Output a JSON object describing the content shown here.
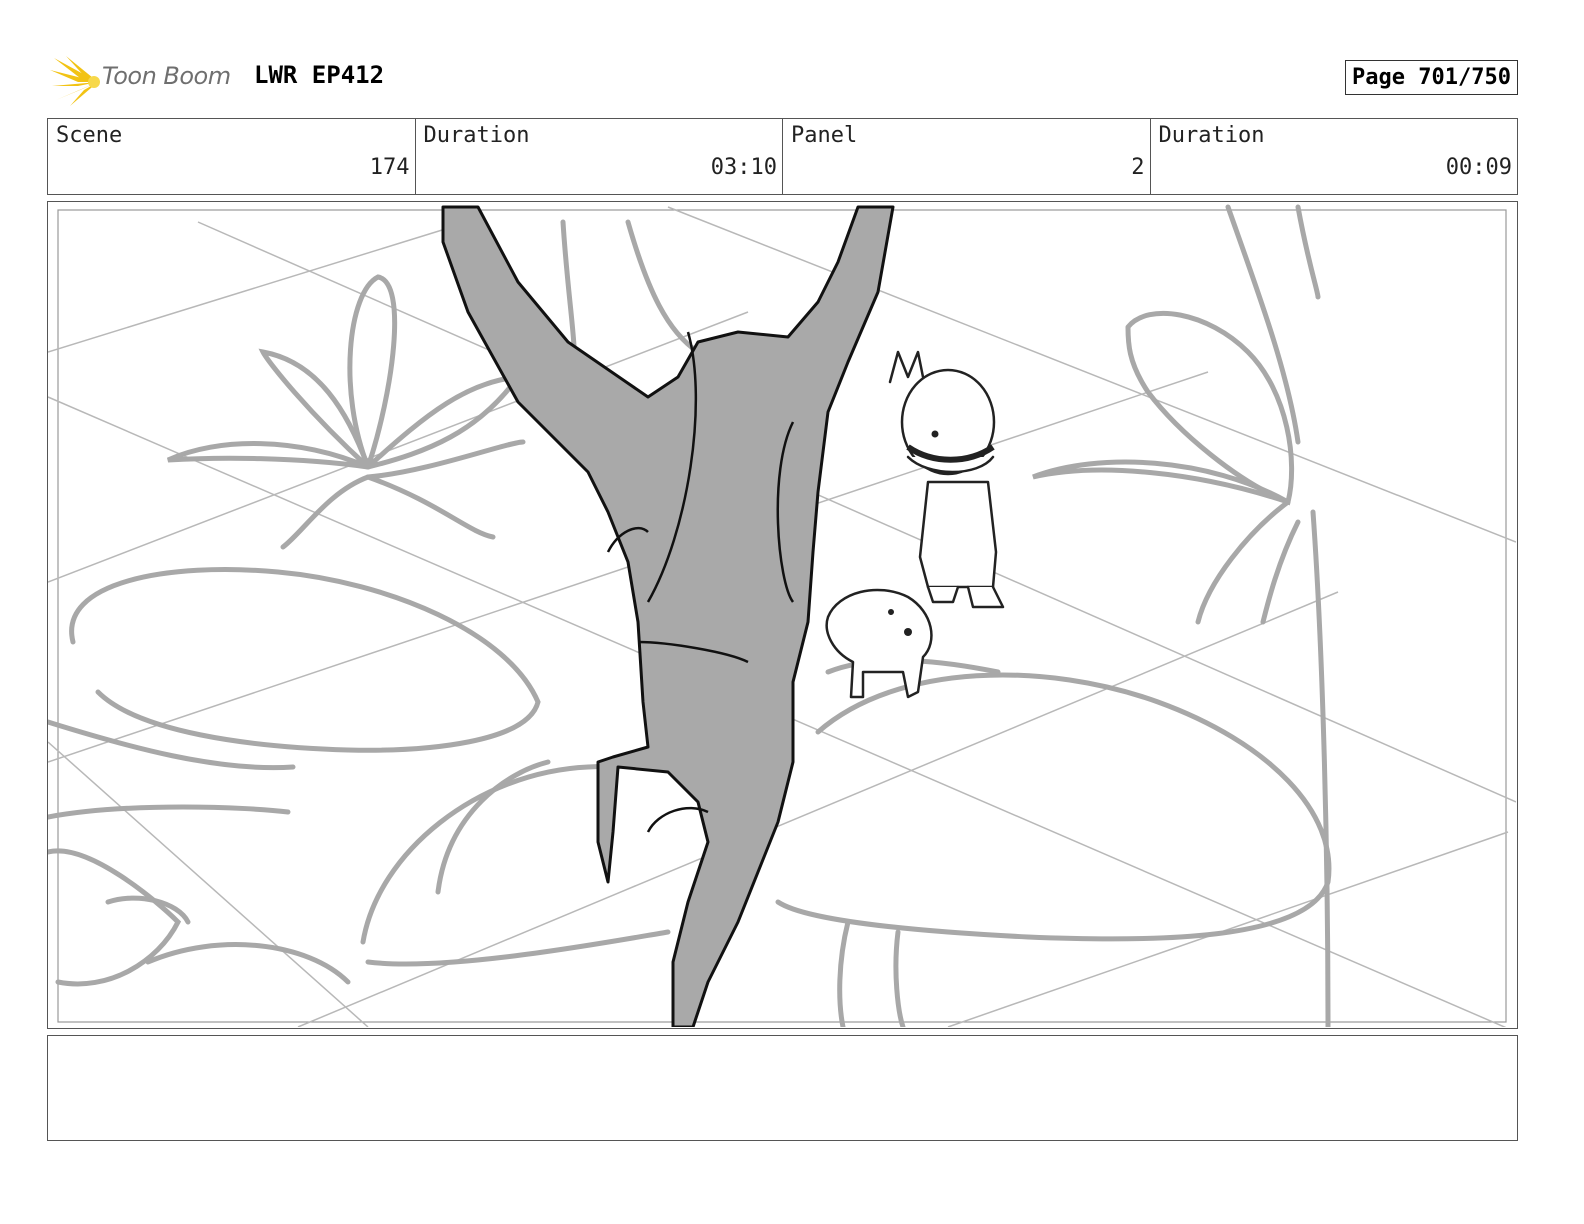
{
  "header": {
    "logo_text": "Toon Boom",
    "project": "LWR EP412",
    "page": "Page 701/750"
  },
  "info": {
    "scene_label": "Scene",
    "scene_value": "174",
    "duration_label": "Duration",
    "duration_value": "03:10",
    "panel_label": "Panel",
    "panel_value": "2",
    "panel_duration_label": "Duration",
    "panel_duration_value": "00:09"
  },
  "icons": {
    "logo": "starburst-logo-icon"
  },
  "colors": {
    "logo_yellow": "#f2c314",
    "sketch_gray": "#a8a8a8",
    "silhouette": "#a9a9a9"
  }
}
